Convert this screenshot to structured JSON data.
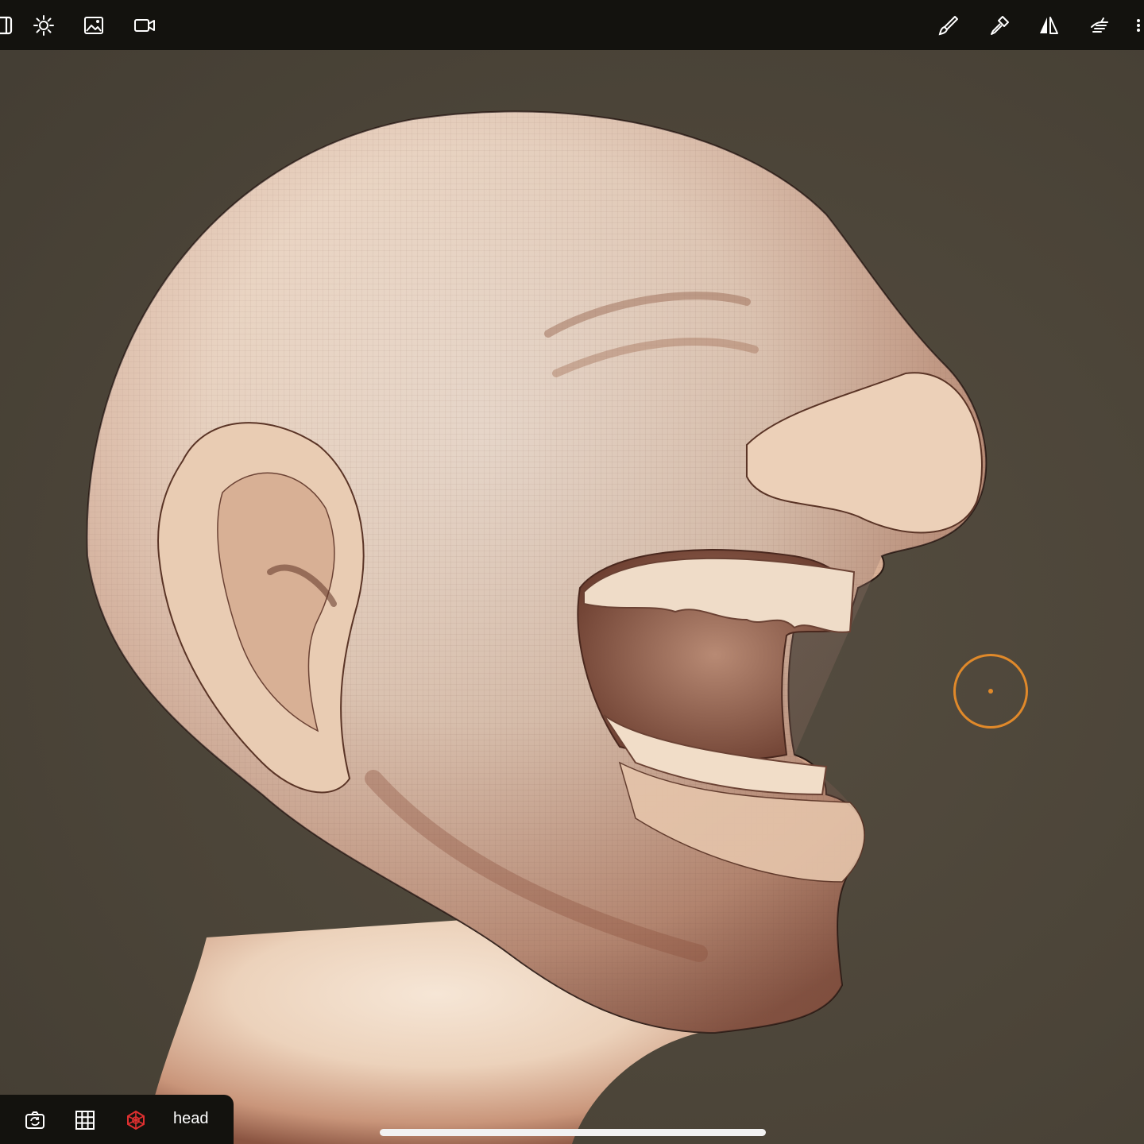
{
  "app": {
    "accent_color": "#e0892a",
    "background_color": "#4d463b",
    "toolbar_color": "#13120e"
  },
  "top_toolbar": {
    "left_icons": [
      "layer-icon",
      "sun-icon",
      "image-icon",
      "video-camera-icon"
    ],
    "right_icons": [
      "brush-icon",
      "painter-brush-icon",
      "symmetry-icon",
      "hand-icon",
      "more-icon"
    ]
  },
  "bottom_toolbar": {
    "icons": [
      "camera-rotate-icon",
      "grid-icon",
      "mesh-icon"
    ],
    "mesh_icon_color": "#e03030",
    "object_name": "head"
  },
  "viewport": {
    "content": "sculpted-head-model",
    "brush_cursor_visible": true
  }
}
